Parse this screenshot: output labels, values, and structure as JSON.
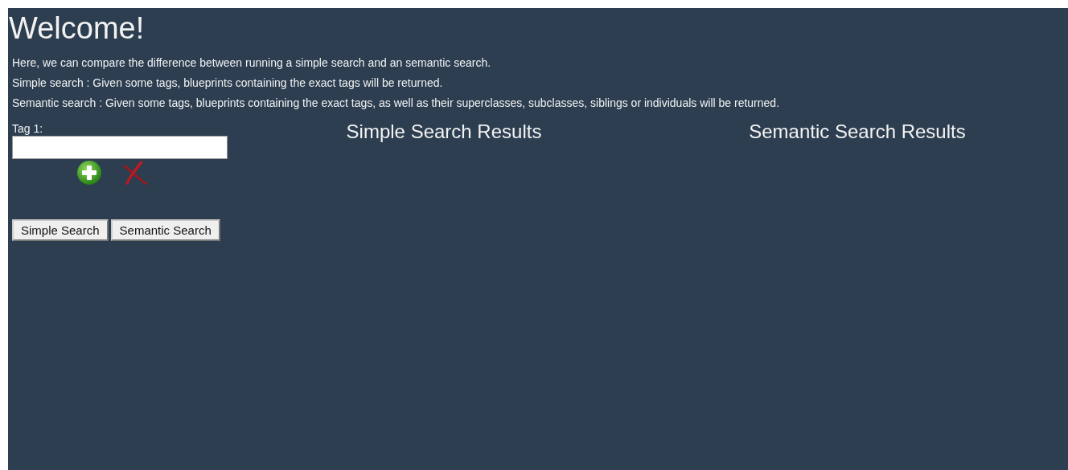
{
  "title": "Welcome!",
  "intro": [
    "Here, we can compare the difference between running a simple search and an semantic search.",
    "Simple search : Given some tags, blueprints containing the exact tags will be returned.",
    "Semantic search : Given some tags, blueprints containing the exact tags, as well as their superclasses, subclasses, siblings or individuals will be returned."
  ],
  "tags": [
    {
      "label": "Tag 1:"
    }
  ],
  "buttons": [
    "Simple Search",
    "Semantic Search"
  ],
  "results": [
    "Simple Search Results",
    "Semantic Search Results"
  ]
}
